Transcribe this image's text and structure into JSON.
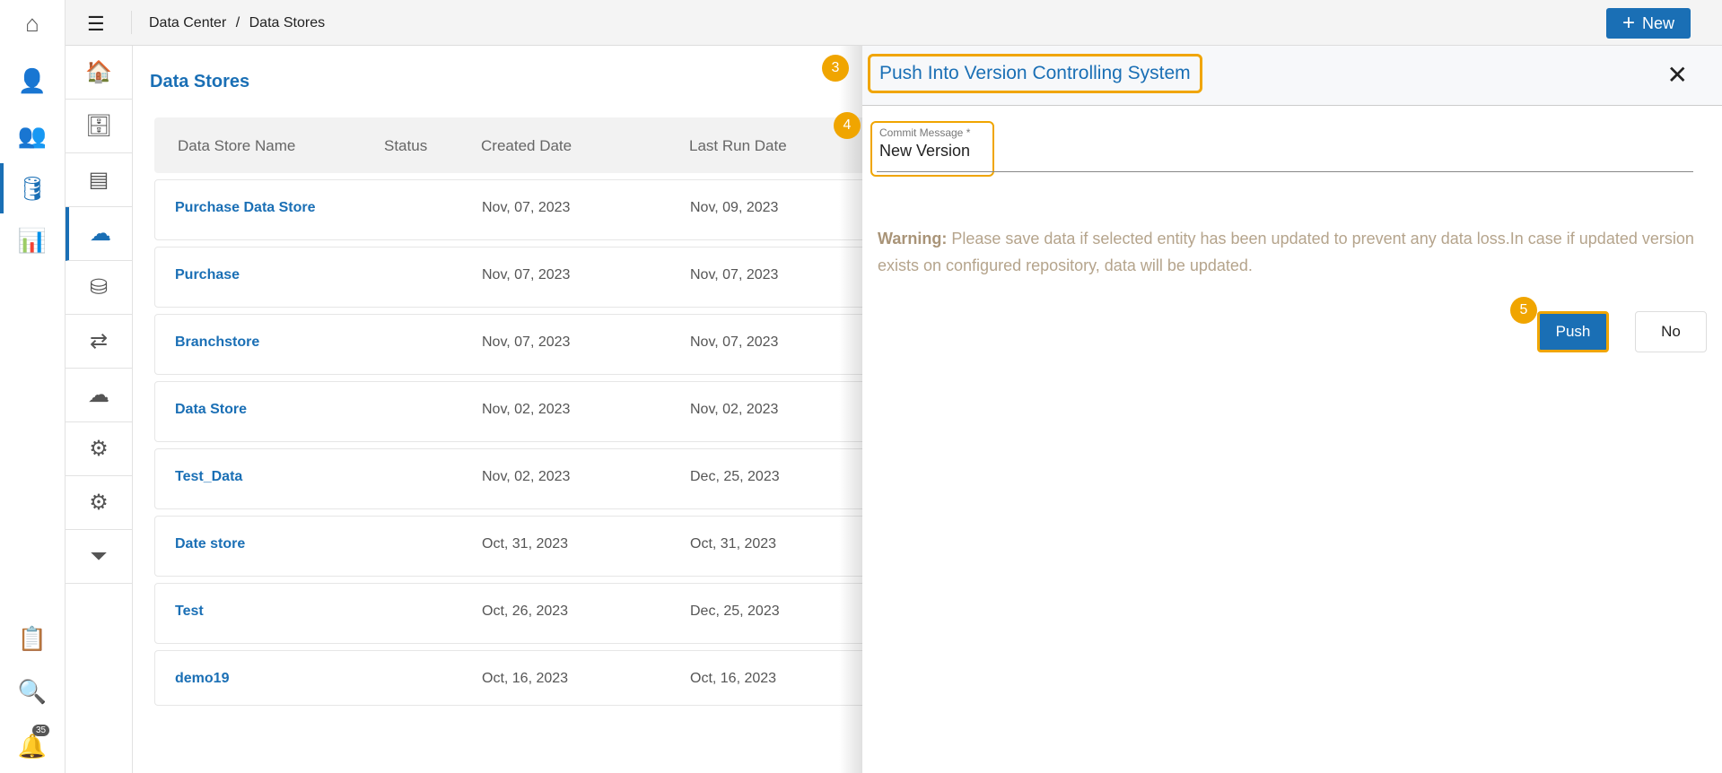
{
  "breadcrumb": {
    "parent": "Data Center",
    "sep": "/",
    "current": "Data Stores"
  },
  "new_button": "New",
  "notification_count": "35",
  "page_title": "Data Stores",
  "table": {
    "headers": [
      "Data Store Name",
      "Status",
      "Created Date",
      "Last Run Date"
    ],
    "rows": [
      {
        "name": "Purchase Data Store",
        "created": "Nov, 07, 2023",
        "last_run": "Nov, 09, 2023"
      },
      {
        "name": "Purchase",
        "created": "Nov, 07, 2023",
        "last_run": "Nov, 07, 2023"
      },
      {
        "name": "Branchstore",
        "created": "Nov, 07, 2023",
        "last_run": "Nov, 07, 2023"
      },
      {
        "name": "Data Store",
        "created": "Nov, 02, 2023",
        "last_run": "Nov, 02, 2023"
      },
      {
        "name": "Test_Data",
        "created": "Nov, 02, 2023",
        "last_run": "Dec, 25, 2023"
      },
      {
        "name": "Date store",
        "created": "Oct, 31, 2023",
        "last_run": "Oct, 31, 2023"
      },
      {
        "name": "Test",
        "created": "Oct, 26, 2023",
        "last_run": "Dec, 25, 2023"
      },
      {
        "name": "demo19",
        "created": "Oct, 16, 2023",
        "last_run": "Oct, 16, 2023"
      }
    ]
  },
  "panel": {
    "title": "Push Into Version Controlling System",
    "close": "✕",
    "commit_label": "Commit Message *",
    "commit_value": "New Version",
    "warning_label": "Warning:",
    "warning_text": " Please save data if selected entity has been updated to prevent any data loss.In case if updated version exists on configured repository, data will be updated.",
    "push": "Push",
    "no": "No"
  },
  "markers": [
    "3",
    "4",
    "5"
  ]
}
